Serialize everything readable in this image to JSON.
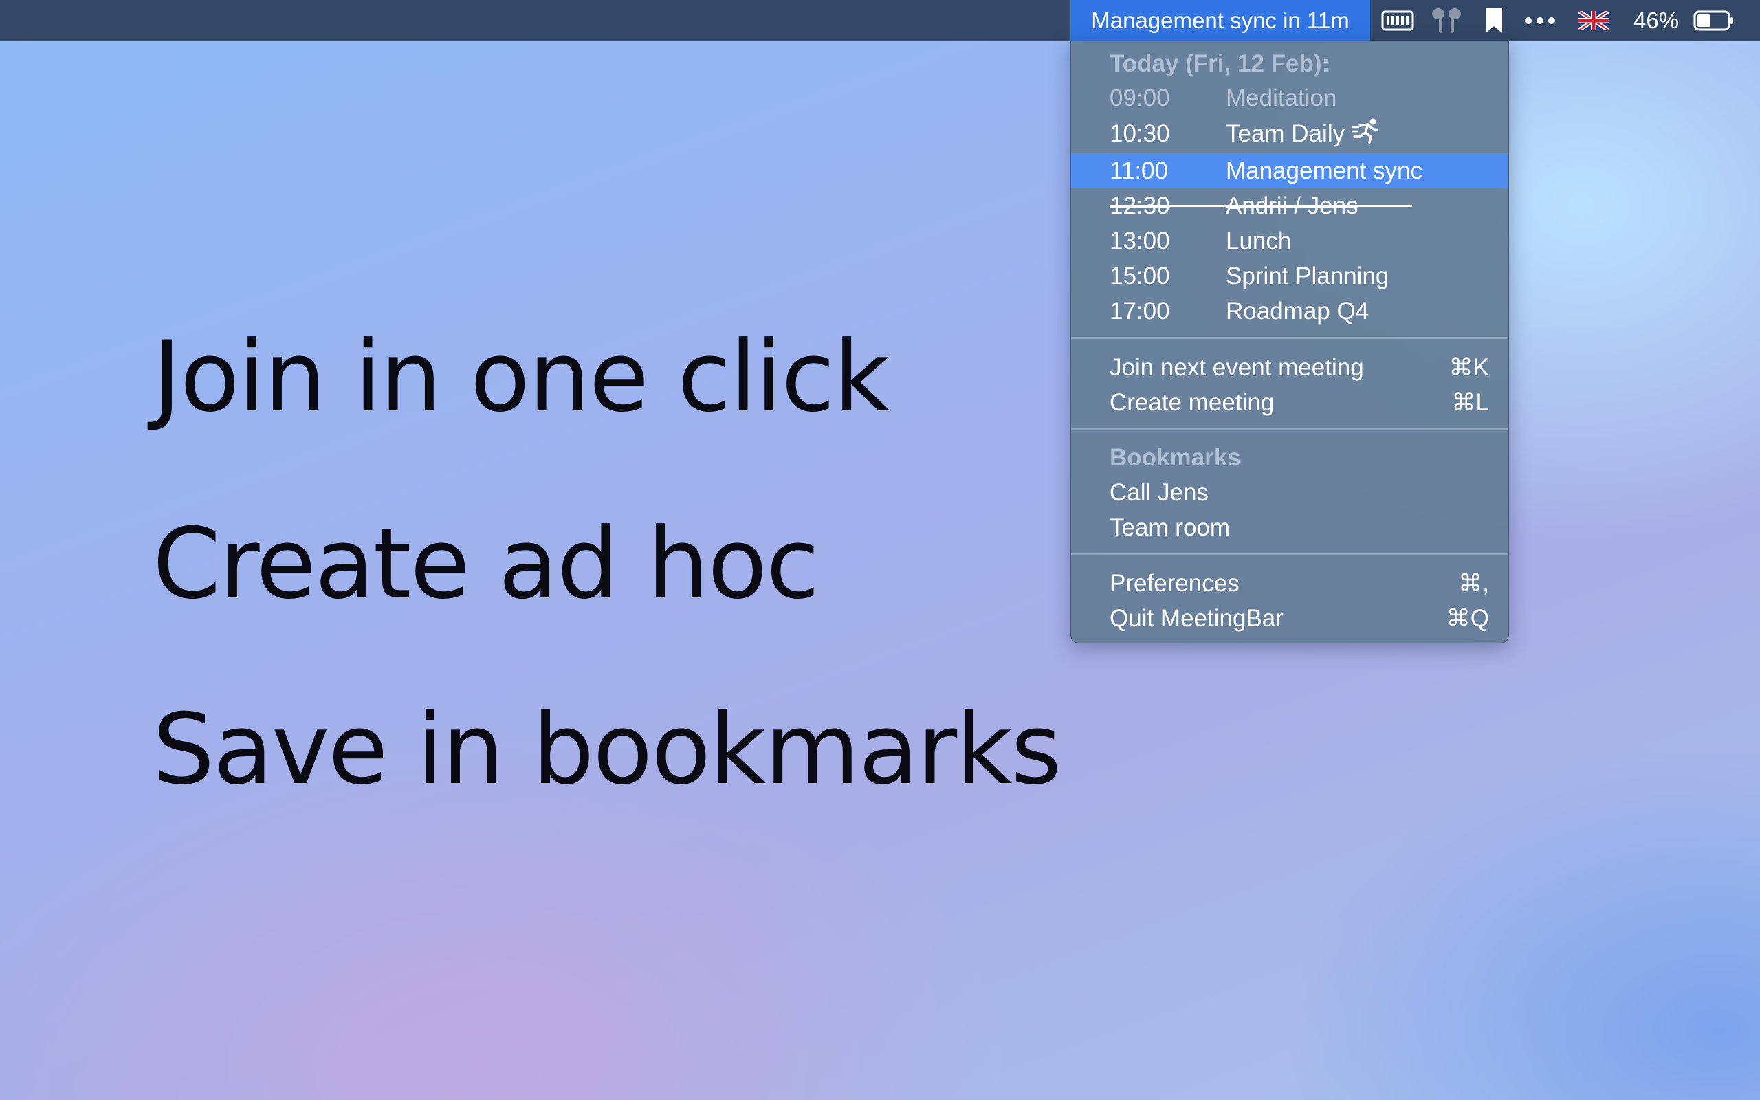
{
  "menubar": {
    "status_title": "Management sync in 11m",
    "battery_percent": "46%",
    "icons": [
      "battery-meter-icon",
      "airpods-icon",
      "bookmark-icon",
      "more-dots-icon",
      "uk-flag-icon",
      "battery-icon"
    ],
    "accent_color": "#3174e4",
    "bar_color": "#324866",
    "battery_level": 0.46
  },
  "headlines": [
    "Join in one click",
    "Create ad hoc",
    "Save in bookmarks"
  ],
  "menu": {
    "today_header": "Today (Fri, 12 Feb):",
    "events": [
      {
        "time": "09:00",
        "title": "Meditation",
        "state": "past"
      },
      {
        "time": "10:30",
        "title": "Team Daily",
        "state": "running",
        "icon": "running-person-icon"
      },
      {
        "time": "11:00",
        "title": "Management sync",
        "state": "highlighted"
      },
      {
        "time": "12:30",
        "title": "Andrii / Jens",
        "state": "declined"
      },
      {
        "time": "13:00",
        "title": "Lunch",
        "state": "upcoming"
      },
      {
        "time": "15:00",
        "title": "Sprint Planning",
        "state": "upcoming"
      },
      {
        "time": "17:00",
        "title": "Roadmap Q4",
        "state": "upcoming"
      }
    ],
    "actions": [
      {
        "label": "Join next event meeting",
        "shortcut": "⌘K"
      },
      {
        "label": "Create meeting",
        "shortcut": "⌘L"
      }
    ],
    "bookmarks_header": "Bookmarks",
    "bookmarks": [
      "Call Jens",
      "Team room"
    ],
    "app_items": [
      {
        "label": "Preferences",
        "shortcut": "⌘,"
      },
      {
        "label": "Quit MeetingBar",
        "shortcut": "⌘Q"
      }
    ],
    "highlight_color": "#4f8ef0"
  }
}
